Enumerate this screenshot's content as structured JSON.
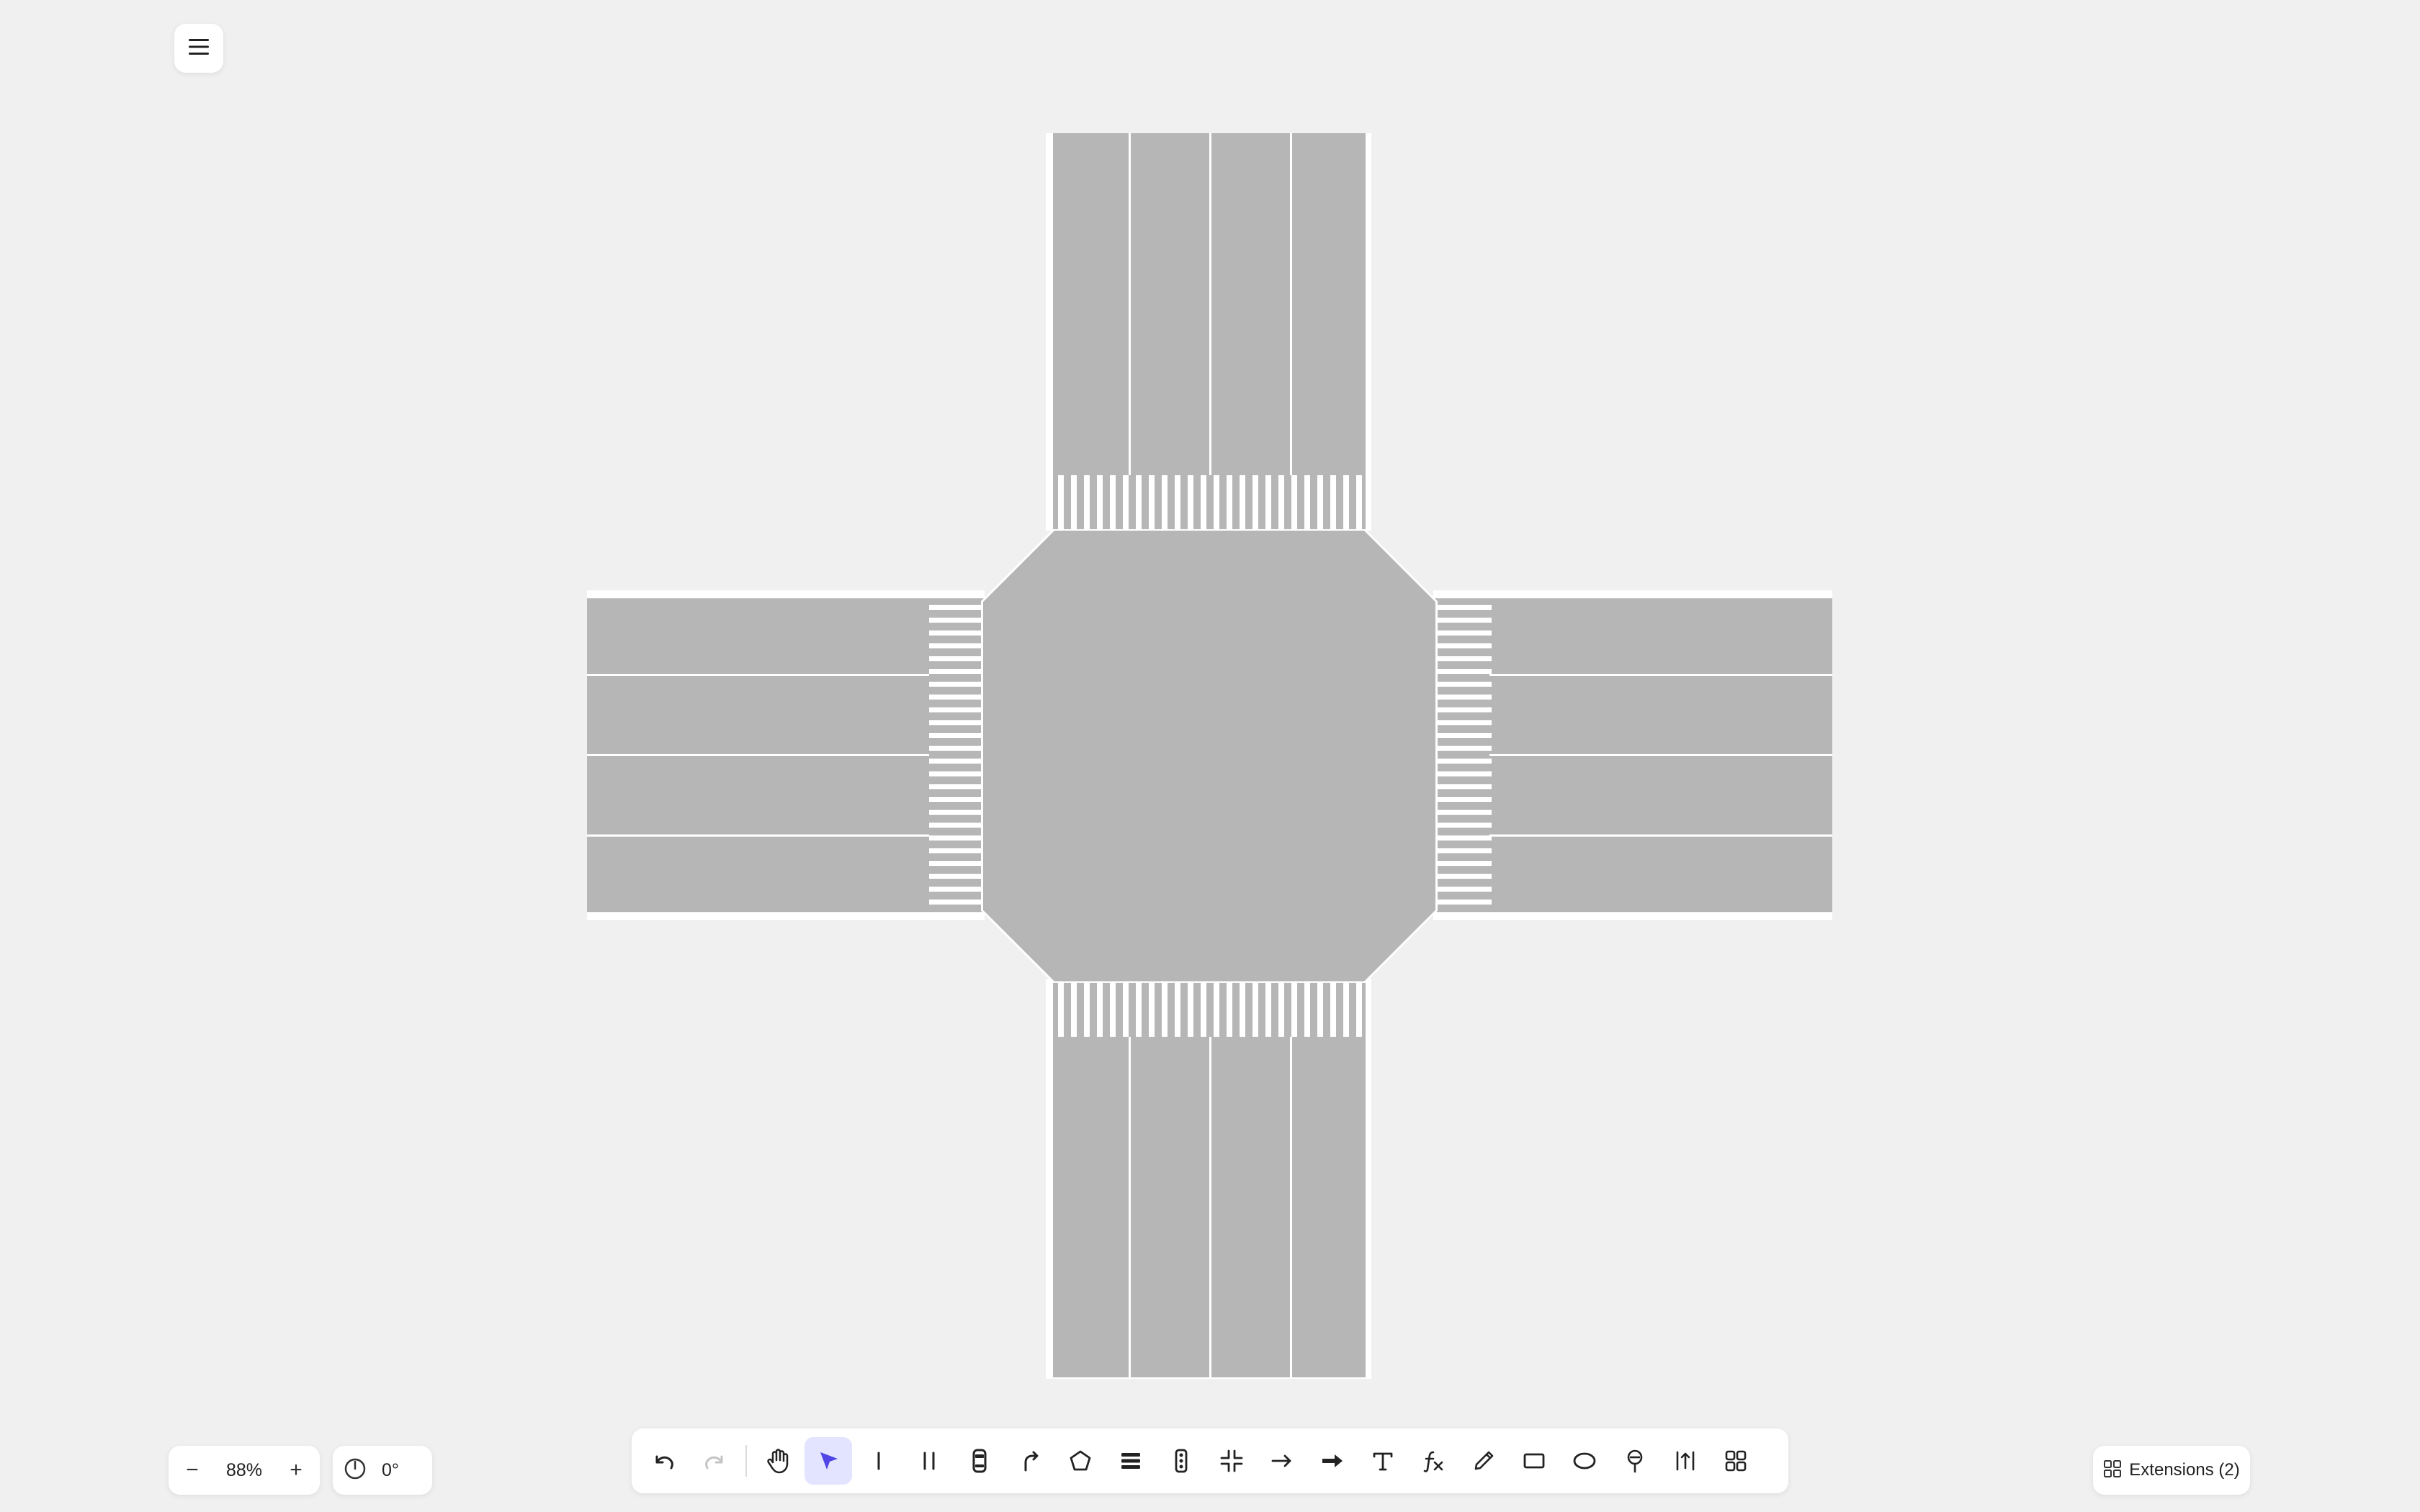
{
  "zoom": {
    "minus_label": "−",
    "value": "88%",
    "plus_label": "+"
  },
  "rotation": {
    "value": "0°",
    "icon": "compass-icon"
  },
  "toolbar": {
    "tools": [
      {
        "name": "undo",
        "icon": "undo-icon",
        "state": "normal"
      },
      {
        "name": "redo",
        "icon": "redo-icon",
        "state": "disabled"
      },
      {
        "name": "pan",
        "icon": "hand-icon",
        "state": "normal"
      },
      {
        "name": "select",
        "icon": "cursor-arrow-icon",
        "state": "active"
      },
      {
        "name": "single-line",
        "icon": "single-line-icon",
        "state": "normal"
      },
      {
        "name": "double-line",
        "icon": "double-line-icon",
        "state": "normal"
      },
      {
        "name": "vehicle",
        "icon": "car-icon",
        "state": "normal"
      },
      {
        "name": "turn-path",
        "icon": "turn-arrow-icon",
        "state": "normal"
      },
      {
        "name": "polygon",
        "icon": "pentagon-icon",
        "state": "normal"
      },
      {
        "name": "road-markings",
        "icon": "stripes-icon",
        "state": "normal"
      },
      {
        "name": "traffic-light",
        "icon": "traffic-light-icon",
        "state": "normal"
      },
      {
        "name": "intersection",
        "icon": "intersection-icon",
        "state": "normal"
      },
      {
        "name": "arrow",
        "icon": "arrow-right-icon",
        "state": "normal"
      },
      {
        "name": "bold-arrow",
        "icon": "bold-arrow-right-icon",
        "state": "normal"
      },
      {
        "name": "text",
        "icon": "text-icon",
        "state": "normal"
      },
      {
        "name": "formula",
        "icon": "function-icon",
        "state": "normal"
      },
      {
        "name": "pencil",
        "icon": "pencil-icon",
        "state": "normal"
      },
      {
        "name": "rectangle",
        "icon": "rectangle-icon",
        "state": "normal"
      },
      {
        "name": "ellipse",
        "icon": "ellipse-icon",
        "state": "normal"
      },
      {
        "name": "sign",
        "icon": "sign-icon",
        "state": "normal"
      },
      {
        "name": "measure",
        "icon": "measure-icon",
        "state": "normal"
      },
      {
        "name": "more",
        "icon": "grid-icon",
        "state": "normal"
      }
    ]
  },
  "extensions": {
    "label": "Extensions (2)",
    "icon": "extensions-grid-icon"
  },
  "menu": {
    "icon": "hamburger-menu-icon"
  },
  "scene": {
    "road_color": "#b6b6b6",
    "marking_color": "#ffffff",
    "background_color": "#f0f0f0",
    "approaches": [
      {
        "name": "north",
        "lanes": 4
      },
      {
        "name": "south",
        "lanes": 4
      },
      {
        "name": "west",
        "lanes": 4
      },
      {
        "name": "east",
        "lanes": 4
      }
    ]
  }
}
